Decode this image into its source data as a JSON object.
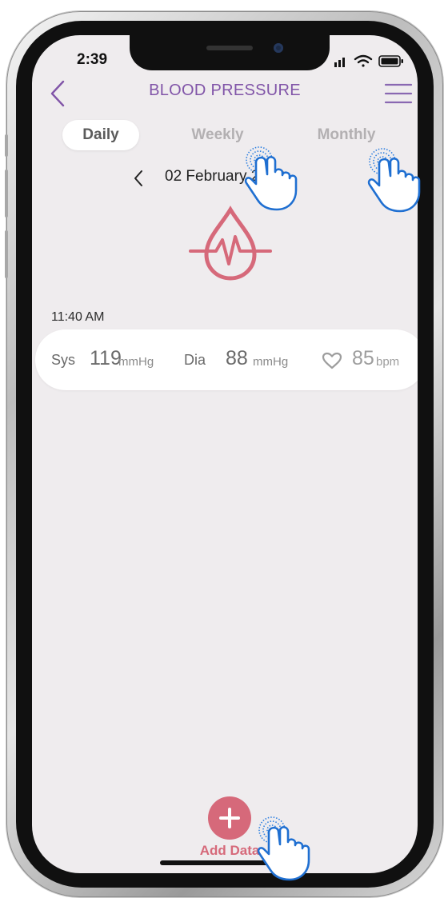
{
  "status_bar": {
    "time": "2:39"
  },
  "header": {
    "title": "BLOOD PRESSURE"
  },
  "tabs": [
    {
      "label": "Daily",
      "active": true
    },
    {
      "label": "Weekly",
      "active": false
    },
    {
      "label": "Monthly",
      "active": false
    }
  ],
  "date_nav": {
    "date": "02 February 2022"
  },
  "entries": [
    {
      "time": "11:40 AM",
      "sys_label": "Sys",
      "sys_value": "119",
      "sys_unit": "mmHg",
      "dia_label": "Dia",
      "dia_value": "88",
      "dia_unit": "mmHg",
      "pulse_value": "85",
      "pulse_unit": "bpm"
    }
  ],
  "add_data": {
    "label": "Add Data"
  },
  "icons": {
    "back": "chevron-left-icon",
    "menu": "hamburger-menu-icon",
    "date_prev": "chevron-left-icon",
    "blood_pressure": "blood-drop-heartbeat-icon",
    "pulse": "heart-outline-icon",
    "add": "plus-icon",
    "tap_hint": "tap-hand-icon"
  },
  "colors": {
    "title": "#8155a8",
    "accent": "#d6697a",
    "hand_outline": "#1f6fd1",
    "hand_dots": "#2f80e0",
    "background": "#efecee"
  }
}
